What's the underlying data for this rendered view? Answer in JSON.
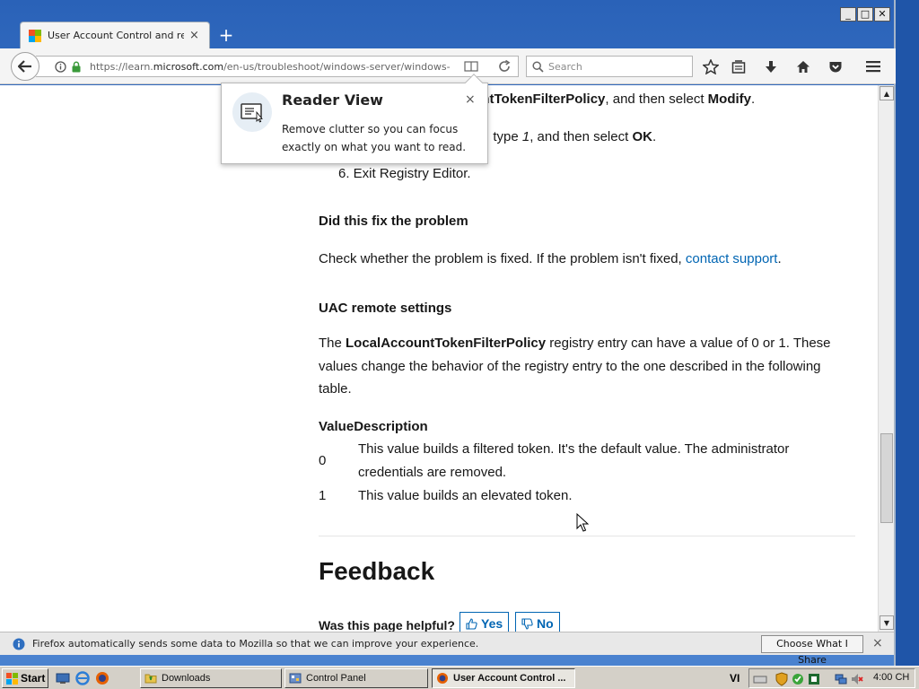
{
  "window": {
    "minimize_label": "_",
    "maximize_label": "□",
    "close_label": "✕"
  },
  "tab": {
    "title": "User Account Control and re...",
    "close_label": "×",
    "new_tab_label": "+"
  },
  "toolbar": {
    "url_prefix": "https://learn.",
    "url_domain": "microsoft.com",
    "url_rest": "/en-us/troubleshoot/windows-server/windows-security/",
    "search_placeholder": "Search",
    "icons": [
      "back-icon",
      "info-icon",
      "lock-icon",
      "reader-view-icon",
      "reload-icon",
      "search-icon",
      "bookmark-star-icon",
      "library-icon",
      "download-icon",
      "home-icon",
      "pocket-icon",
      "menu-icon"
    ]
  },
  "popup": {
    "title": "Reader View",
    "text": "Remove clutter so you can focus exactly on what you want to read.",
    "close_label": "×"
  },
  "article": {
    "step4_tail_bold": "ountTokenFilterPolicy",
    "step4_tail_mid": ", and then select ",
    "step4_tail_bold2": "Modify",
    "step4_tail_end": ".",
    "step5_tail_a": ", type ",
    "step5_tail_italic": "1",
    "step5_tail_b": ", and then select ",
    "step5_tail_bold": "OK",
    "step5_tail_end": ".",
    "step6": "6. Exit Registry Editor.",
    "fix_heading": "Did this fix the problem",
    "fix_text": "Check whether the problem is fixed. If the problem isn't fixed, ",
    "fix_link": "contact support",
    "fix_end": ".",
    "uac_heading": "UAC remote settings",
    "uac_para_pre": "The ",
    "uac_para_bold": "LocalAccountTokenFilterPolicy",
    "uac_para_post": " registry entry can have a value of 0 or 1. These values change the behavior of the registry entry to the one described in the following table.",
    "table_header": "ValueDescription",
    "table_rows": [
      {
        "value": "0",
        "description": "This value builds a filtered token. It's the default value. The administrator credentials are removed."
      },
      {
        "value": "1",
        "description": "This value builds an elevated token."
      }
    ],
    "feedback_title": "Feedback",
    "helpful_question": "Was this page helpful?",
    "yes_label": "Yes",
    "no_label": "No"
  },
  "notification": {
    "text": "Firefox automatically sends some data to Mozilla so that we can improve your experience.",
    "button": "Choose What I Share",
    "close_label": "×"
  },
  "taskbar": {
    "start_label": "Start",
    "tasks": [
      {
        "label": "Downloads",
        "active": false
      },
      {
        "label": "Control Panel",
        "active": false
      },
      {
        "label": "User Account Control ...",
        "active": true
      }
    ],
    "language": "VI",
    "clock": "4:00 CH"
  },
  "colors": {
    "link": "#0065b3",
    "titlebar": "#2a62b8",
    "taskbar": "#d4d0c8"
  }
}
